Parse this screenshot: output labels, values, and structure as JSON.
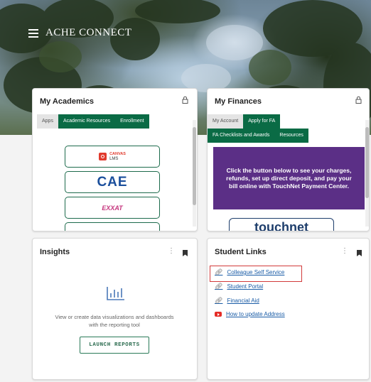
{
  "header": {
    "brand": "ACHE CONNECT"
  },
  "academics": {
    "title": "My Academics",
    "tabs": [
      {
        "label": "Apps",
        "active": false
      },
      {
        "label": "Academic Resources",
        "active": true
      },
      {
        "label": "Enrollment",
        "active": true
      }
    ],
    "apps": {
      "canvas_line1": "CANVAS",
      "canvas_line2": "LMS",
      "cae": "CAE",
      "exxat": "EXXAT"
    }
  },
  "finances": {
    "title": "My Finances",
    "tabs": [
      {
        "label": "My Account",
        "active": false
      },
      {
        "label": "Apply for FA",
        "active": true
      },
      {
        "label": "FA Checklists and Awards",
        "active": true
      },
      {
        "label": "Resources",
        "active": true
      }
    ],
    "banner": "Click the button below to see your charges, refunds, set up direct deposit, and pay your bill online with TouchNet Payment Center.",
    "touchnet": "touchnet"
  },
  "insights": {
    "title": "Insights",
    "description": "View or create data visualizations and dashboards with the reporting tool",
    "launch_label": "LAUNCH REPORTS"
  },
  "student_links": {
    "title": "Student Links",
    "links": [
      {
        "label": "Colleague Self Service",
        "icon": "link-icon"
      },
      {
        "label": "Student Portal",
        "icon": "link-icon"
      },
      {
        "label": "Financial Aid",
        "icon": "link-icon"
      },
      {
        "label": "How to update Address",
        "icon": "youtube-icon"
      }
    ]
  },
  "colors": {
    "accent_green": "#0a6b45",
    "purple": "#5b2f86",
    "highlight_red": "#d23a3a",
    "link_blue": "#1a5ca6"
  }
}
